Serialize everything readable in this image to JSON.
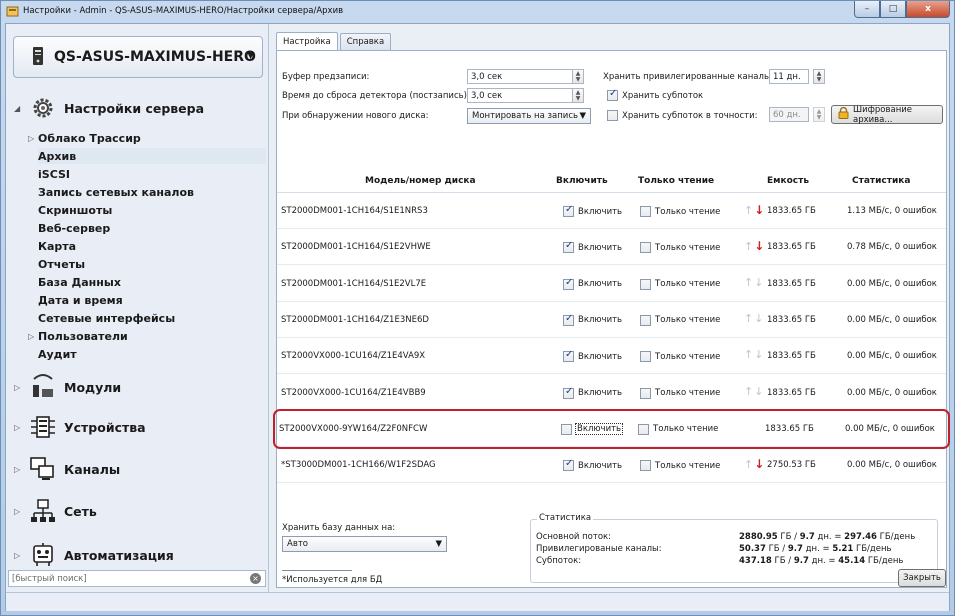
{
  "window": {
    "title": "Настройки - Admin - QS-ASUS-MAXIMUS-HERO/Настройки сервера/Архив",
    "minimize": "–",
    "maximize": "□",
    "close": "x"
  },
  "sidebar": {
    "server_name": "QS-ASUS-MAXIMUS-HERO",
    "tree": {
      "server_settings": "Настройки сервера",
      "items": [
        {
          "label": "Облако Трассир",
          "expandable": true
        },
        {
          "label": "Архив",
          "selected": true
        },
        {
          "label": "iSCSI"
        },
        {
          "label": "Запись сетевых каналов"
        },
        {
          "label": "Скриншоты"
        },
        {
          "label": "Веб-сервер"
        },
        {
          "label": "Карта"
        },
        {
          "label": "Отчеты"
        },
        {
          "label": "База Данных"
        },
        {
          "label": "Дата и время"
        },
        {
          "label": "Сетевые интерфейсы"
        },
        {
          "label": "Пользователи",
          "expandable": true
        },
        {
          "label": "Аудит"
        }
      ],
      "modules": "Модули",
      "devices": "Устройства",
      "channels": "Каналы",
      "network": "Сеть",
      "automation": "Автоматизация"
    },
    "quick_search_placeholder": "[быстрый поиск]"
  },
  "tabs": [
    {
      "label": "Настройка",
      "active": true
    },
    {
      "label": "Справка",
      "active": false
    }
  ],
  "settings": {
    "prebuffer_label": "Буфер предзаписи:",
    "prebuffer_value": "3,0 сек",
    "detector_reset_label": "Время до сброса детектора (постзапись):",
    "detector_reset_value": "3,0 сек",
    "new_disk_label": "При обнаружении нового диска:",
    "new_disk_value": "Монтировать на запись",
    "keep_priv_label": "Хранить привилегированные каналы:",
    "keep_priv_value": "11 дн.",
    "keep_substream_label": "Хранить субпоток",
    "keep_substream_checked": true,
    "keep_substream_exact_label": "Хранить субпоток в точности:",
    "keep_substream_exact_checked": false,
    "keep_substream_exact_value": "60 дн.",
    "encrypt_button": "Шифрование архива..."
  },
  "table": {
    "columns": [
      "Модель/номер диска",
      "Включить",
      "Только чтение",
      "Емкость",
      "Статистика"
    ],
    "enable_label": "Включить",
    "readonly_label": "Только чтение",
    "rows": [
      {
        "model": "ST2000DM001-1CH164/S1E1NRS3",
        "enabled": true,
        "readonly": false,
        "arrows": "red",
        "capacity": "1833.65 ГБ",
        "stats": "1.13 МБ/с, 0 ошибок"
      },
      {
        "model": "ST2000DM001-1CH164/S1E2VHWE",
        "enabled": true,
        "readonly": false,
        "arrows": "red",
        "capacity": "1833.65 ГБ",
        "stats": "0.78 МБ/с, 0 ошибок"
      },
      {
        "model": "ST2000DM001-1CH164/S1E2VL7E",
        "enabled": true,
        "readonly": false,
        "arrows": "gray",
        "capacity": "1833.65 ГБ",
        "stats": "0.00 МБ/с, 0 ошибок"
      },
      {
        "model": "ST2000DM001-1CH164/Z1E3NE6D",
        "enabled": true,
        "readonly": false,
        "arrows": "gray",
        "capacity": "1833.65 ГБ",
        "stats": "0.00 МБ/с, 0 ошибок"
      },
      {
        "model": "ST2000VX000-1CU164/Z1E4VA9X",
        "enabled": true,
        "readonly": false,
        "arrows": "gray",
        "capacity": "1833.65 ГБ",
        "stats": "0.00 МБ/с, 0 ошибок"
      },
      {
        "model": "ST2000VX000-1CU164/Z1E4VBB9",
        "enabled": true,
        "readonly": false,
        "arrows": "gray",
        "capacity": "1833.65 ГБ",
        "stats": "0.00 МБ/с, 0 ошибок"
      },
      {
        "model": "ST2000VX000-9YW164/Z2F0NFCW",
        "enabled": false,
        "readonly": false,
        "arrows": "none",
        "capacity": "1833.65 ГБ",
        "stats": "0.00 МБ/с, 0 ошибок",
        "highlighted": true
      },
      {
        "model": "*ST3000DM001-1CH166/W1F2SDAG",
        "enabled": true,
        "readonly": false,
        "arrows": "red",
        "capacity": "2750.53 ГБ",
        "stats": "0.00 МБ/с, 0 ошибок"
      }
    ]
  },
  "bottom": {
    "db_label": "Хранить базу данных на:",
    "db_value": "Авто",
    "db_note": "*Используется для БД",
    "stats_title": "Статистика",
    "stats": [
      {
        "label": "Основной поток:",
        "a": "2880.95",
        "b": "9.7",
        "c": "297.46"
      },
      {
        "label": "Привилегированые каналы:",
        "a": "50.37",
        "b": "9.7",
        "c": "5.21"
      },
      {
        "label": "Субпоток:",
        "a": "437.18",
        "b": "9.7",
        "c": "45.14"
      }
    ],
    "unit_gb": "ГБ",
    "unit_days": "дн.",
    "unit_per_day": "ГБ/день"
  },
  "close_button": "Закрыть"
}
